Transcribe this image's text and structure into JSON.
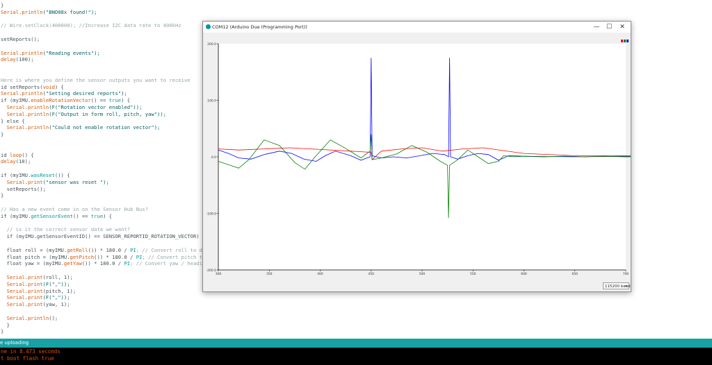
{
  "editor": {
    "lines": [
      [
        [
          "}",
          ""
        ]
      ],
      [
        [
          "Serial",
          "kw"
        ],
        [
          ".",
          ""
        ],
        [
          "println",
          "kw"
        ],
        [
          "(\"BNO08x found!\");",
          "str"
        ]
      ],
      [],
      [
        [
          "// Wire.setClock(400000); //Increase I2C data rate to 400kHz",
          "cm"
        ]
      ],
      [],
      [
        [
          "setReports();",
          ""
        ]
      ],
      [],
      [
        [
          "Serial",
          "kw"
        ],
        [
          ".",
          ""
        ],
        [
          "println",
          "kw"
        ],
        [
          "(\"Reading events\");",
          "str"
        ]
      ],
      [
        [
          "delay",
          "kw"
        ],
        [
          "(100);",
          ""
        ]
      ],
      [],
      [],
      [
        [
          "Here is where you define the sensor outputs you want to receive",
          "cm"
        ]
      ],
      [
        [
          "id ",
          ""
        ],
        [
          "setReports",
          ""
        ],
        [
          "(",
          ""
        ],
        [
          "void",
          "kw"
        ],
        [
          ") {",
          ""
        ]
      ],
      [
        [
          "Serial",
          "kw"
        ],
        [
          ".",
          ""
        ],
        [
          "println",
          "kw"
        ],
        [
          "(\"Setting desired reports\");",
          "str"
        ]
      ],
      [
        [
          "if (myIMU.",
          ""
        ],
        [
          "enableRotationVector",
          "kw"
        ],
        [
          "() == ",
          ""
        ],
        [
          "true",
          "kw2"
        ],
        [
          ") {",
          ""
        ]
      ],
      [
        [
          "  ",
          ""
        ],
        [
          "Serial",
          "kw"
        ],
        [
          ".",
          ""
        ],
        [
          "println",
          "kw"
        ],
        [
          "(F(\"Rotation vector enabled\"));",
          "str"
        ]
      ],
      [
        [
          "  ",
          ""
        ],
        [
          "Serial",
          "kw"
        ],
        [
          ".",
          ""
        ],
        [
          "println",
          "kw"
        ],
        [
          "(F(\"Output in form roll, pitch, yaw\"));",
          "str"
        ]
      ],
      [
        [
          "} else {",
          ""
        ]
      ],
      [
        [
          "  ",
          ""
        ],
        [
          "Serial",
          "kw"
        ],
        [
          ".",
          ""
        ],
        [
          "println",
          "kw"
        ],
        [
          "(\"Could not enable rotation vector\");",
          "str"
        ]
      ],
      [
        [
          "}",
          ""
        ]
      ],
      [],
      [],
      [
        [
          "id ",
          ""
        ],
        [
          "loop",
          "kw"
        ],
        [
          "() {",
          ""
        ]
      ],
      [
        [
          "delay",
          "kw"
        ],
        [
          "(10);",
          ""
        ]
      ],
      [],
      [
        [
          "if (myIMU.",
          ""
        ],
        [
          "wasReset",
          "kw2"
        ],
        [
          "()) {",
          ""
        ]
      ],
      [
        [
          "  ",
          ""
        ],
        [
          "Serial",
          "kw"
        ],
        [
          ".",
          ""
        ],
        [
          "print",
          "kw"
        ],
        [
          "(\"sensor was reset \");",
          "str"
        ]
      ],
      [
        [
          "  setReports();",
          ""
        ]
      ],
      [
        [
          "}",
          ""
        ]
      ],
      [],
      [
        [
          "// Has a new event come in on the Sensor Hub Bus?",
          "cm"
        ]
      ],
      [
        [
          "if (myIMU.",
          ""
        ],
        [
          "getSensorEvent",
          "kw2"
        ],
        [
          "() == ",
          ""
        ],
        [
          "true",
          "kw2"
        ],
        [
          ") {",
          ""
        ]
      ],
      [],
      [
        [
          "  // is it the correct sensor data we want?",
          "cm"
        ]
      ],
      [
        [
          "  if (myIMU.getSensorEventID() == SENSOR_REPORTID_ROTATION_VECTOR) {",
          ""
        ]
      ],
      [],
      [
        [
          "  float roll = (myIMU.",
          ""
        ],
        [
          "getRoll",
          "kw"
        ],
        [
          "()) * 180.0 / ",
          ""
        ],
        [
          "PI",
          "kw2"
        ],
        [
          "; // Convert roll to de",
          "cm"
        ]
      ],
      [
        [
          "  float pitch = (myIMU.",
          ""
        ],
        [
          "getPitch",
          "kw"
        ],
        [
          "()) * 180.0 / ",
          ""
        ],
        [
          "PI",
          "kw2"
        ],
        [
          "; // Convert pitch to",
          "cm"
        ]
      ],
      [
        [
          "  float yaw = (myIMU.",
          ""
        ],
        [
          "getYaw",
          "kw"
        ],
        [
          "()) * 180.0 / ",
          ""
        ],
        [
          "PI",
          "kw2"
        ],
        [
          "; // Convert yaw / headin",
          "cm"
        ]
      ],
      [],
      [
        [
          "  ",
          ""
        ],
        [
          "Serial",
          "kw"
        ],
        [
          ".",
          ""
        ],
        [
          "print",
          "kw"
        ],
        [
          "(roll, 1);",
          ""
        ]
      ],
      [
        [
          "  ",
          ""
        ],
        [
          "Serial",
          "kw"
        ],
        [
          ".",
          ""
        ],
        [
          "print",
          "kw"
        ],
        [
          "(F(\",\"));",
          "str"
        ]
      ],
      [
        [
          "  ",
          ""
        ],
        [
          "Serial",
          "kw"
        ],
        [
          ".",
          ""
        ],
        [
          "print",
          "kw"
        ],
        [
          "(pitch, 1);",
          ""
        ]
      ],
      [
        [
          "  ",
          ""
        ],
        [
          "Serial",
          "kw"
        ],
        [
          ".",
          ""
        ],
        [
          "print",
          "kw"
        ],
        [
          "(F(\",\"));",
          "str"
        ]
      ],
      [
        [
          "  ",
          ""
        ],
        [
          "Serial",
          "kw"
        ],
        [
          ".",
          ""
        ],
        [
          "print",
          "kw"
        ],
        [
          "(yaw, 1);",
          ""
        ]
      ],
      [],
      [
        [
          "  ",
          ""
        ],
        [
          "Serial",
          "kw"
        ],
        [
          ".",
          ""
        ],
        [
          "println",
          "kw"
        ],
        [
          "();",
          ""
        ]
      ],
      [
        [
          "  }",
          ""
        ]
      ],
      [
        [
          "}",
          ""
        ]
      ]
    ]
  },
  "status_bar": {
    "text": "e uploading"
  },
  "console": {
    "lines": [
      "ne in 8.473 seconds",
      "t boot flash true"
    ]
  },
  "plotter": {
    "title": "COM12 (Arduino Due (Programming Port))",
    "window_buttons": {
      "minimize": "—",
      "maximize": "☐",
      "close": "✕"
    },
    "baud": "115200 baud",
    "baud_chevron": "▾",
    "colors": {
      "blue": "#0000ff",
      "red": "#ff0000",
      "green": "#008000"
    }
  },
  "chart_data": {
    "type": "line",
    "ylim": [
      -200,
      200
    ],
    "xlim": [
      300,
      700
    ],
    "y_ticks": [
      "200.0",
      "100.0",
      "0.0",
      "-100.0",
      "-200.0"
    ],
    "y_tick_values": [
      200,
      100,
      0,
      -100,
      -200
    ],
    "x_ticks": [
      "300",
      "350",
      "400",
      "450",
      "500",
      "550",
      "600",
      "650",
      "700"
    ],
    "x_tick_values": [
      300,
      350,
      400,
      450,
      500,
      550,
      600,
      650,
      700
    ],
    "series": [
      {
        "color": "#0000ff",
        "x": [
          300,
          310,
          320,
          332,
          345,
          360,
          372,
          384,
          396,
          405,
          415,
          430,
          440,
          449,
          450,
          451,
          460,
          472,
          485,
          498,
          510,
          522,
          526,
          527,
          528,
          535,
          545,
          555,
          565,
          575,
          585,
          600,
          620,
          640,
          660,
          680,
          700,
          720,
          727,
          728,
          729,
          740,
          760,
          775,
          790,
          798,
          799,
          800,
          810,
          820,
          835,
          850,
          870,
          900
        ],
        "y": [
          12,
          6,
          -2,
          -4,
          4,
          10,
          6,
          -4,
          -8,
          2,
          10,
          2,
          -6,
          0,
          175,
          2,
          -2,
          0,
          -2,
          2,
          6,
          4,
          0,
          175,
          0,
          -4,
          2,
          6,
          4,
          -6,
          2,
          1,
          0,
          1,
          0,
          1,
          0,
          1,
          0,
          175,
          2,
          2,
          3,
          6,
          4,
          -6,
          175,
          -28,
          -22,
          -10,
          -6,
          0,
          6,
          4
        ]
      },
      {
        "color": "#ff0000",
        "x": [
          300,
          320,
          345,
          370,
          400,
          430,
          450,
          451,
          460,
          480,
          500,
          520,
          540,
          560,
          600,
          650,
          700,
          727,
          728,
          740,
          760,
          780,
          790,
          800,
          810,
          820,
          830,
          845,
          860,
          880,
          900
        ],
        "y": [
          14,
          12,
          14,
          16,
          13,
          10,
          8,
          -5,
          10,
          14,
          16,
          10,
          14,
          16,
          6,
          2,
          2,
          3,
          -4,
          3,
          4,
          10,
          18,
          28,
          24,
          10,
          4,
          4,
          3,
          4,
          3
        ]
      },
      {
        "color": "#008000",
        "x": [
          300,
          310,
          320,
          330,
          345,
          360,
          375,
          385,
          395,
          410,
          425,
          440,
          449,
          450,
          451,
          460,
          475,
          490,
          505,
          518,
          525,
          526,
          527,
          535,
          545,
          555,
          565,
          575,
          580,
          590,
          600,
          650,
          700,
          727,
          728,
          729,
          740,
          760,
          780,
          790,
          800,
          810,
          815,
          816,
          817,
          825,
          845,
          860,
          880,
          900
        ],
        "y": [
          -8,
          -14,
          -20,
          -5,
          30,
          20,
          -10,
          -22,
          0,
          30,
          15,
          -2,
          10,
          40,
          -5,
          -2,
          5,
          20,
          8,
          -8,
          -15,
          -108,
          -15,
          -5,
          12,
          0,
          -12,
          -8,
          2,
          0,
          1,
          0,
          1,
          0,
          1,
          0,
          2,
          0,
          -20,
          -45,
          -70,
          -82,
          -135,
          -90,
          -92,
          -100,
          -98,
          -90,
          -90,
          -90
        ]
      }
    ]
  }
}
